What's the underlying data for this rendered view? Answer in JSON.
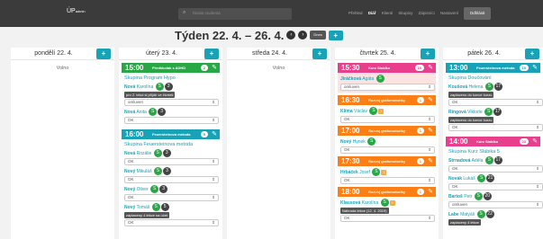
{
  "app": {
    "brand": "ÚP",
    "brand_sub": "admin",
    "search_placeholder": "hledat studenta",
    "menu": [
      "Přehled",
      "Diář",
      "Klienti",
      "Skupiny",
      "Zápisníci",
      "Nastavení"
    ],
    "active_menu": "Diář",
    "logout": "Odhlásit"
  },
  "week": {
    "title": "Týden  22. 4.  –  26. 4.",
    "today": "Dnes",
    "add": "+"
  },
  "days": [
    {
      "name": "pondělí 22. 4.",
      "add": "+",
      "empty": "Volno"
    },
    {
      "name": "úterý 23. 4.",
      "add": "+",
      "lessons": [
        {
          "time": "15:00",
          "type": "Předškolák s ADHD",
          "count": "2",
          "group": "Skupina Program Hypo",
          "students": [
            {
              "last": "Nová",
              "first": "Karolína",
              "badges": [
                "S",
                "3"
              ],
              "note": "pro 2. lekci si přijde ve čtvrtek",
              "status": "omluven"
            },
            {
              "last": "Nová",
              "first": "Anita",
              "badges": [
                "S",
                "3"
              ],
              "status": "OK"
            }
          ]
        },
        {
          "time": "16:00",
          "type": "Feuersteinova metoda",
          "count": "5",
          "group": "Skupina Feuersteinova metoda",
          "students": [
            {
              "last": "Nová",
              "first": "Rozálie",
              "badges": [
                "S",
                "3"
              ],
              "status": "OK"
            },
            {
              "last": "Nový",
              "first": "Mikuláš",
              "badges": [
                "S",
                "3"
              ],
              "status": "OK"
            },
            {
              "last": "Nový",
              "first": "Oliver",
              "badges": [
                "S",
                "3"
              ],
              "status": "OK"
            },
            {
              "last": "Nový",
              "first": "Tomáš",
              "badges": [
                "S",
                "5"
              ],
              "note": "zaplaceny 4 lekce na účet",
              "status": "OK"
            }
          ]
        }
      ]
    },
    {
      "name": "středa 24. 4.",
      "add": "+",
      "empty": "Volno"
    },
    {
      "name": "čtvrtek 25. 4.",
      "add": "+",
      "lessons": [
        {
          "time": "15:30",
          "type": "Kurz Slabika",
          "count": "10",
          "students": [
            {
              "last": "Jiráčková",
              "first": "Agáta",
              "badges": [
                "S"
              ],
              "status": "omluven"
            }
          ]
        },
        {
          "time": "16:30",
          "type": "Rozvoj grafomotoriky",
          "count": "1",
          "students": [
            {
              "last": "Klíma",
              "first": "Václav",
              "badges": [
                "S",
                "!"
              ],
              "status": "OK"
            }
          ]
        },
        {
          "time": "17:00",
          "type": "Rozvoj grafomotoriky",
          "count": "1",
          "students": [
            {
              "last": "Nový",
              "first": "Hynek",
              "badges": [
                "S"
              ],
              "status": "OK"
            }
          ]
        },
        {
          "time": "17:30",
          "type": "Rozvoj grafomotoriky",
          "count": "1",
          "students": [
            {
              "last": "Hrbáček",
              "first": "Josef",
              "badges": [
                "S",
                "!"
              ],
              "status": "OK"
            }
          ]
        },
        {
          "time": "18:00",
          "type": "Rozvoj grafomotoriky",
          "count": "1",
          "students": [
            {
              "last": "Klausová",
              "first": "Karolína",
              "badges": [
                "S",
                "!"
              ],
              "note": "Náhrada lekce (12. 4. 2019)",
              "status": "OK"
            }
          ]
        }
      ]
    },
    {
      "name": "pátek 26. 4.",
      "add": "+",
      "lessons": [
        {
          "time": "13:00",
          "type": "Feuersteinova metoda",
          "count": "10",
          "group": "Skupina Doučování",
          "students": [
            {
              "last": "Koušová",
              "first": "Helena",
              "badges": [
                "S",
                "17"
              ],
              "note": "zaplaceno do konce kurzu",
              "status": "OK"
            },
            {
              "last": "Ringová",
              "first": "Viktorie",
              "badges": [
                "S",
                "17"
              ],
              "note": "zaplaceno do konce kurzu",
              "status": "OK"
            }
          ]
        },
        {
          "time": "14:00",
          "type": "Kurz Slabika",
          "count": "23",
          "group": "Skupina Kurz Slabika 5",
          "students": [
            {
              "last": "Strnadová",
              "first": "Adéla",
              "badges": [
                "S",
                "17"
              ],
              "status": "OK"
            },
            {
              "last": "Novák",
              "first": "Lukáš",
              "badges": [
                "S",
                "21"
              ],
              "status": "OK"
            },
            {
              "last": "Bartoš",
              "first": "Petr",
              "badges": [
                "S",
                "20"
              ],
              "status": "omluven"
            },
            {
              "last": "Labe",
              "first": "Matyáš",
              "badges": [
                "S",
                "22"
              ],
              "note": "zaplaceny 4 lekce",
              "status": "OK"
            }
          ]
        }
      ]
    }
  ]
}
